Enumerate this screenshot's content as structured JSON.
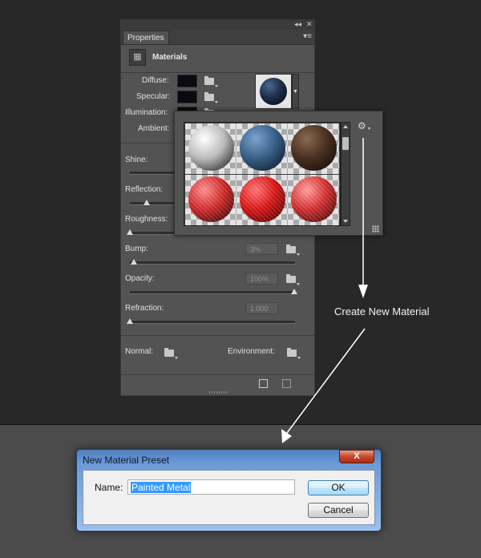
{
  "panel": {
    "tab_label": "Properties",
    "collapse_glyph": "◂◂",
    "close_glyph": "✕",
    "menu_glyph": "▾≡",
    "header_title": "Materials",
    "header_icon": "materials-icon",
    "labels": {
      "diffuse": "Diffuse:",
      "specular": "Specular:",
      "illumination": "Illumination:",
      "ambient": "Ambient:",
      "shine": "Shine:",
      "reflection": "Reflection:",
      "roughness": "Roughness:",
      "bump": "Bump:",
      "opacity": "Opacity:",
      "refraction": "Refraction:",
      "normal": "Normal:",
      "environment": "Environment:"
    },
    "values": {
      "bump": "3%",
      "opacity": "100%",
      "refraction": "1.000"
    },
    "slider_levels": {
      "bump": 0.03,
      "opacity": 1.0,
      "refraction": 0.0
    },
    "colors": {
      "panel_bg": "#535353",
      "swatch": "#0a0a12"
    }
  },
  "picker": {
    "materials": [
      {
        "name": "white-glossy",
        "colors": [
          "#ffffff",
          "#bdbdbd",
          "#3a3a3a"
        ]
      },
      {
        "name": "blue-glossy",
        "colors": [
          "#7aa4cf",
          "#3a6186",
          "#12233a"
        ]
      },
      {
        "name": "brown-wood",
        "colors": [
          "#8a6a52",
          "#4a3020",
          "#1e120a"
        ]
      },
      {
        "name": "red-fabric-1",
        "colors": [
          "#ff8a8a",
          "#cc2525",
          "#4a0808"
        ]
      },
      {
        "name": "red-fabric-2",
        "colors": [
          "#ff7070",
          "#d41010",
          "#5a0505"
        ]
      },
      {
        "name": "red-fabric-3",
        "colors": [
          "#ff9a9a",
          "#cf2a2a",
          "#520a0a"
        ]
      }
    ],
    "settings_icon": "gear-icon"
  },
  "annotation": {
    "text": "Create New Material"
  },
  "dialog": {
    "title": "New Material Preset",
    "close_glyph": "X",
    "name_label": "Name:",
    "name_value": "Painted Metal",
    "ok_label": "OK",
    "cancel_label": "Cancel"
  }
}
